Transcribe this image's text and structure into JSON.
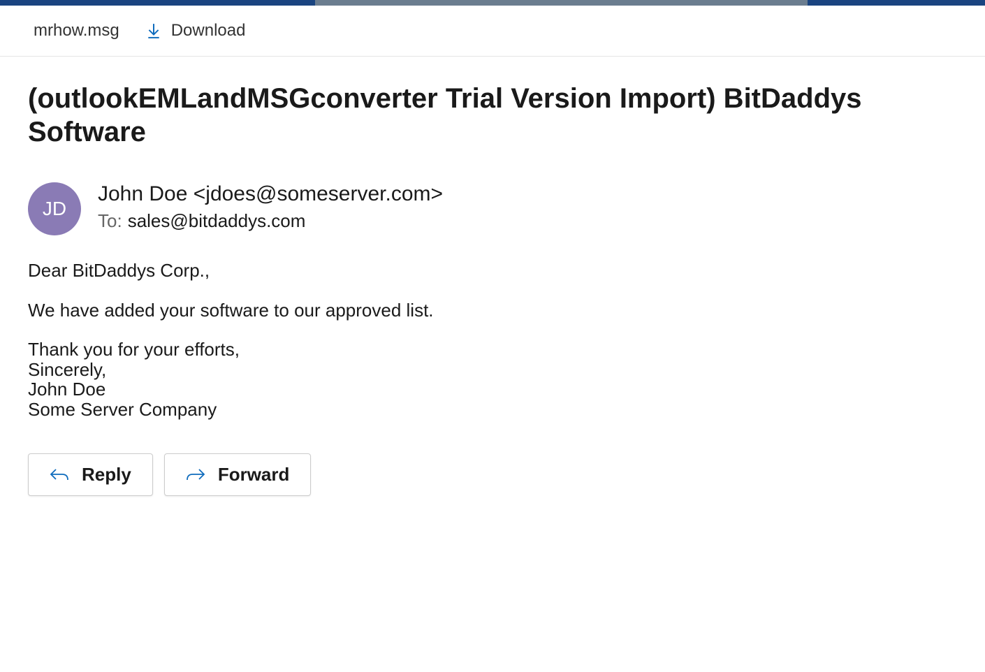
{
  "header": {
    "filename": "mrhow.msg",
    "download_label": "Download"
  },
  "message": {
    "subject": "(outlookEMLandMSGconverter Trial Version Import) BitDaddys Software",
    "avatar_initials": "JD",
    "sender_display": "John Doe <jdoes@someserver.com>",
    "to_label": "To:",
    "to_value": "sales@bitdaddys.com",
    "body_lines": [
      "Dear BitDaddys Corp.,",
      "",
      "We have added your software to our approved list.",
      "",
      "Thank you for your efforts,",
      "Sincerely,",
      "John Doe",
      "Some Server Company"
    ]
  },
  "actions": {
    "reply_label": "Reply",
    "forward_label": "Forward"
  }
}
